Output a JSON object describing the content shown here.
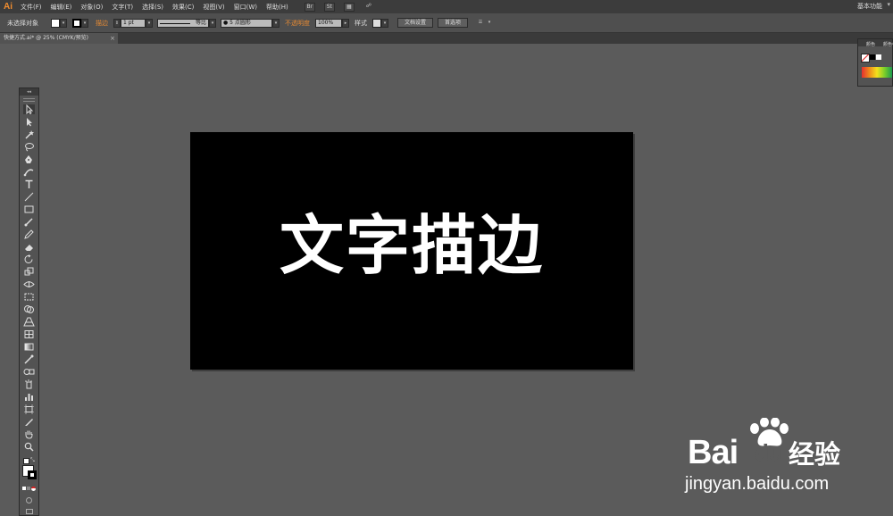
{
  "app": {
    "logo": "Ai"
  },
  "menu": [
    "文件(F)",
    "编辑(E)",
    "对象(O)",
    "文字(T)",
    "选择(S)",
    "效果(C)",
    "视图(V)",
    "窗口(W)",
    "帮助(H)"
  ],
  "menubar_buttons": {
    "br": "Br",
    "st": "St"
  },
  "workspace": {
    "label": "基本功能",
    "arrow": "▾"
  },
  "control": {
    "selection_label": "未选择对象",
    "stroke_label": "描边",
    "stroke_value": "1 pt",
    "profile_label": "等比",
    "brush_label": "5 点圆形",
    "opacity_label": "不透明度",
    "opacity_value": "100%",
    "style_label": "样式",
    "doc_setup": "文档设置",
    "preferences": "首选项"
  },
  "document_tab": {
    "title": "快捷方式.ai* @ 25% (CMYK/预览)",
    "close": "×"
  },
  "panel": {
    "tab_color": "颜色",
    "tab_guide": "颜色参考"
  },
  "toolbox": {
    "collapse": "◂◂"
  },
  "artboard": {
    "headline": "文字描边"
  },
  "watermark": {
    "bai": "Bai",
    "du": "du",
    "jingyan": "经验",
    "url": "jingyan.baidu.com"
  },
  "colors": {
    "accent": "#ef8c2f",
    "app_bg": "#5b5b5b",
    "artboard": "#000000",
    "text": "#ffffff"
  }
}
